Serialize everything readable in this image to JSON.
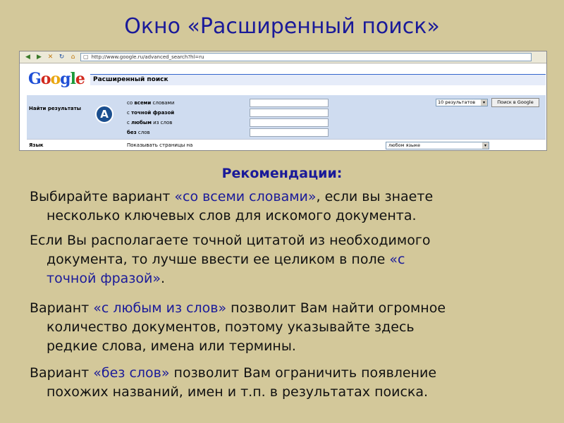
{
  "slide": {
    "title": "Окно «Расширенный поиск»"
  },
  "browser": {
    "url": "http://www.google.ru/advanced_search?hl=ru",
    "logo": [
      "G",
      "o",
      "o",
      "g",
      "l",
      "e"
    ],
    "header": "Расширенный поиск",
    "find_results_label": "Найти результаты",
    "badge": "A",
    "options": [
      {
        "pre": "со ",
        "bold": "всеми",
        "post": " словами"
      },
      {
        "pre": "с ",
        "bold": "точной фразой",
        "post": ""
      },
      {
        "pre": "с ",
        "bold": "любым",
        "post": " из слов"
      },
      {
        "pre": "",
        "bold": "без",
        "post": " слов"
      }
    ],
    "results_select": "10 результатов",
    "search_button": "Поиск в Google",
    "language_label": "Язык",
    "language_text": "Показывать страницы на",
    "language_select": "любом языке"
  },
  "recommendations": {
    "title": "Рекомендации:",
    "p1_a": "Выбирайте вариант ",
    "p1_hl": "«со всеми словами»",
    "p1_b": ", если вы знаете",
    "p1_c": "несколько ключевых слов для искомого документа.",
    "p2_a": "Если Вы располагаете точной цитатой из необходимого",
    "p2_b": "документа, то лучше ввести ее целиком в поле ",
    "p2_hl1": "«с",
    "p2_hl2": "точной фразой»",
    "p2_c": ".",
    "p3_a": "Вариант ",
    "p3_hl": "«с любым из слов»",
    "p3_b": " позволит Вам найти огромное",
    "p3_c": "количество документов, поэтому указывайте здесь",
    "p3_d": "редкие слова, имена или термины.",
    "p4_a": "Вариант ",
    "p4_hl": "«без слов»",
    "p4_b": " позволит Вам ограничить появление",
    "p4_c": "похожих названий, имен и т.п. в результатах поиска."
  }
}
